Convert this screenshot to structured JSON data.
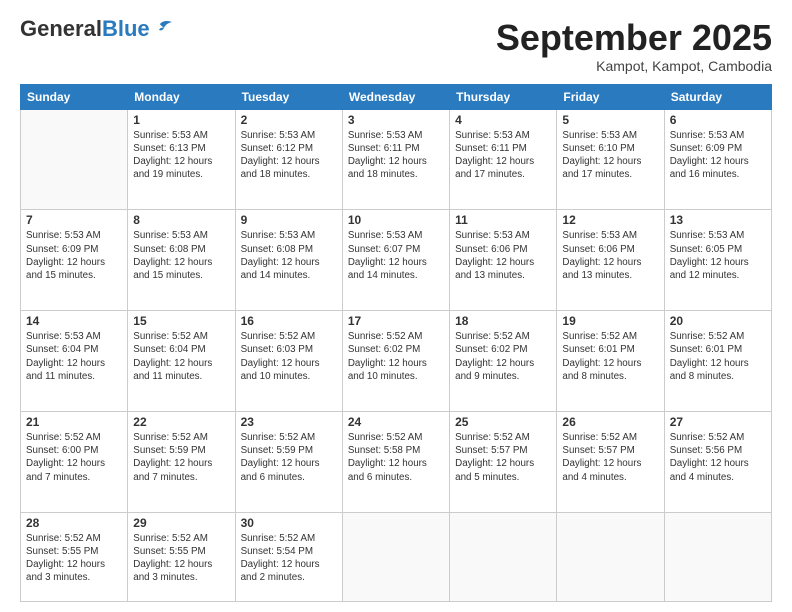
{
  "header": {
    "logo_general": "General",
    "logo_blue": "Blue",
    "month": "September 2025",
    "location": "Kampot, Kampot, Cambodia"
  },
  "weekdays": [
    "Sunday",
    "Monday",
    "Tuesday",
    "Wednesday",
    "Thursday",
    "Friday",
    "Saturday"
  ],
  "weeks": [
    [
      {
        "day": "",
        "info": ""
      },
      {
        "day": "1",
        "info": "Sunrise: 5:53 AM\nSunset: 6:13 PM\nDaylight: 12 hours\nand 19 minutes."
      },
      {
        "day": "2",
        "info": "Sunrise: 5:53 AM\nSunset: 6:12 PM\nDaylight: 12 hours\nand 18 minutes."
      },
      {
        "day": "3",
        "info": "Sunrise: 5:53 AM\nSunset: 6:11 PM\nDaylight: 12 hours\nand 18 minutes."
      },
      {
        "day": "4",
        "info": "Sunrise: 5:53 AM\nSunset: 6:11 PM\nDaylight: 12 hours\nand 17 minutes."
      },
      {
        "day": "5",
        "info": "Sunrise: 5:53 AM\nSunset: 6:10 PM\nDaylight: 12 hours\nand 17 minutes."
      },
      {
        "day": "6",
        "info": "Sunrise: 5:53 AM\nSunset: 6:09 PM\nDaylight: 12 hours\nand 16 minutes."
      }
    ],
    [
      {
        "day": "7",
        "info": "Sunrise: 5:53 AM\nSunset: 6:09 PM\nDaylight: 12 hours\nand 15 minutes."
      },
      {
        "day": "8",
        "info": "Sunrise: 5:53 AM\nSunset: 6:08 PM\nDaylight: 12 hours\nand 15 minutes."
      },
      {
        "day": "9",
        "info": "Sunrise: 5:53 AM\nSunset: 6:08 PM\nDaylight: 12 hours\nand 14 minutes."
      },
      {
        "day": "10",
        "info": "Sunrise: 5:53 AM\nSunset: 6:07 PM\nDaylight: 12 hours\nand 14 minutes."
      },
      {
        "day": "11",
        "info": "Sunrise: 5:53 AM\nSunset: 6:06 PM\nDaylight: 12 hours\nand 13 minutes."
      },
      {
        "day": "12",
        "info": "Sunrise: 5:53 AM\nSunset: 6:06 PM\nDaylight: 12 hours\nand 13 minutes."
      },
      {
        "day": "13",
        "info": "Sunrise: 5:53 AM\nSunset: 6:05 PM\nDaylight: 12 hours\nand 12 minutes."
      }
    ],
    [
      {
        "day": "14",
        "info": "Sunrise: 5:53 AM\nSunset: 6:04 PM\nDaylight: 12 hours\nand 11 minutes."
      },
      {
        "day": "15",
        "info": "Sunrise: 5:52 AM\nSunset: 6:04 PM\nDaylight: 12 hours\nand 11 minutes."
      },
      {
        "day": "16",
        "info": "Sunrise: 5:52 AM\nSunset: 6:03 PM\nDaylight: 12 hours\nand 10 minutes."
      },
      {
        "day": "17",
        "info": "Sunrise: 5:52 AM\nSunset: 6:02 PM\nDaylight: 12 hours\nand 10 minutes."
      },
      {
        "day": "18",
        "info": "Sunrise: 5:52 AM\nSunset: 6:02 PM\nDaylight: 12 hours\nand 9 minutes."
      },
      {
        "day": "19",
        "info": "Sunrise: 5:52 AM\nSunset: 6:01 PM\nDaylight: 12 hours\nand 8 minutes."
      },
      {
        "day": "20",
        "info": "Sunrise: 5:52 AM\nSunset: 6:01 PM\nDaylight: 12 hours\nand 8 minutes."
      }
    ],
    [
      {
        "day": "21",
        "info": "Sunrise: 5:52 AM\nSunset: 6:00 PM\nDaylight: 12 hours\nand 7 minutes."
      },
      {
        "day": "22",
        "info": "Sunrise: 5:52 AM\nSunset: 5:59 PM\nDaylight: 12 hours\nand 7 minutes."
      },
      {
        "day": "23",
        "info": "Sunrise: 5:52 AM\nSunset: 5:59 PM\nDaylight: 12 hours\nand 6 minutes."
      },
      {
        "day": "24",
        "info": "Sunrise: 5:52 AM\nSunset: 5:58 PM\nDaylight: 12 hours\nand 6 minutes."
      },
      {
        "day": "25",
        "info": "Sunrise: 5:52 AM\nSunset: 5:57 PM\nDaylight: 12 hours\nand 5 minutes."
      },
      {
        "day": "26",
        "info": "Sunrise: 5:52 AM\nSunset: 5:57 PM\nDaylight: 12 hours\nand 4 minutes."
      },
      {
        "day": "27",
        "info": "Sunrise: 5:52 AM\nSunset: 5:56 PM\nDaylight: 12 hours\nand 4 minutes."
      }
    ],
    [
      {
        "day": "28",
        "info": "Sunrise: 5:52 AM\nSunset: 5:55 PM\nDaylight: 12 hours\nand 3 minutes."
      },
      {
        "day": "29",
        "info": "Sunrise: 5:52 AM\nSunset: 5:55 PM\nDaylight: 12 hours\nand 3 minutes."
      },
      {
        "day": "30",
        "info": "Sunrise: 5:52 AM\nSunset: 5:54 PM\nDaylight: 12 hours\nand 2 minutes."
      },
      {
        "day": "",
        "info": ""
      },
      {
        "day": "",
        "info": ""
      },
      {
        "day": "",
        "info": ""
      },
      {
        "day": "",
        "info": ""
      }
    ]
  ]
}
